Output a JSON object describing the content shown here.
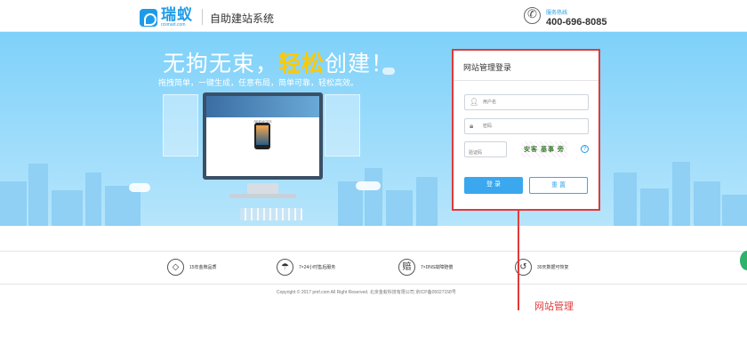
{
  "header": {
    "logo_cn": "瑞蚁",
    "logo_en": "rzsmart.com",
    "system_title": "自助建站系统",
    "service_label": "服务热线",
    "service_phone": "400-696-8085"
  },
  "banner": {
    "slogan_before": "无拘无束，",
    "slogan_highlight": "轻松",
    "slogan_after": "创建！",
    "sub": "拖拽简单，一键生成，任意布局，简单可靠，轻松高效。",
    "screen_label": "SERVICES"
  },
  "login": {
    "title": "网站管理登录",
    "username_placeholder": "用户名",
    "password_placeholder": "密码",
    "captcha_placeholder": "验证码",
    "captcha_text": "安客  基事  旁",
    "login_button": "登 录",
    "reset_button": "重 置"
  },
  "features": [
    {
      "icon": "diamond-icon",
      "glyph": "◇",
      "label": "15年金牌品质"
    },
    {
      "icon": "umbrella-icon",
      "glyph": "☂",
      "label": "7×24小时售后服务"
    },
    {
      "icon": "compensate-icon",
      "glyph": "赔",
      "label": "7×DNS故障赔偿"
    },
    {
      "icon": "restore-icon",
      "glyph": "↺",
      "label": "30天数据可恢复"
    }
  ],
  "footer": {
    "copyright": "Copyright © 2017 pmf.com All Right Reserved. 北京金蚁科技有限公司 京ICP备05027158号"
  },
  "annotation": {
    "label": "网站管理"
  },
  "colors": {
    "brand_blue": "#1e9be8",
    "highlight_yellow": "#ffc900",
    "annotation_red": "#e03a3a"
  }
}
